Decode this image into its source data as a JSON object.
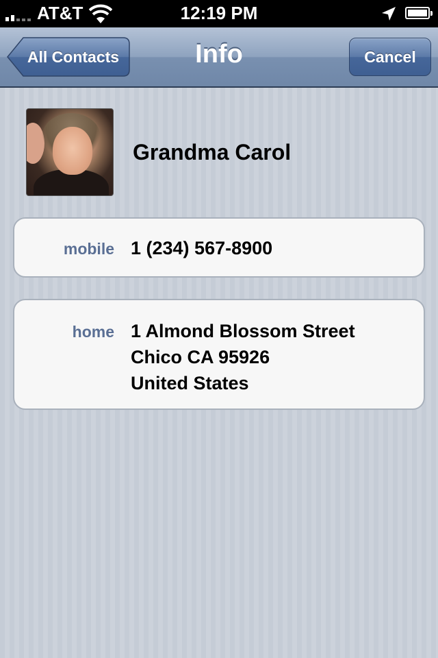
{
  "status_bar": {
    "carrier": "AT&T",
    "time": "12:19 PM",
    "signal_bars": 2
  },
  "nav": {
    "back_label": "All Contacts",
    "title": "Info",
    "cancel_label": "Cancel"
  },
  "contact": {
    "name": "Grandma Carol",
    "phone": {
      "label": "mobile",
      "value": "1 (234) 567-8900"
    },
    "address": {
      "label": "home",
      "line1": "1 Almond Blossom Street",
      "line2": "Chico CA 95926",
      "line3": "United States"
    }
  },
  "colors": {
    "nav_bar": "#7990b0",
    "label_blue": "#5a6f94",
    "card_bg": "#f7f7f7"
  }
}
